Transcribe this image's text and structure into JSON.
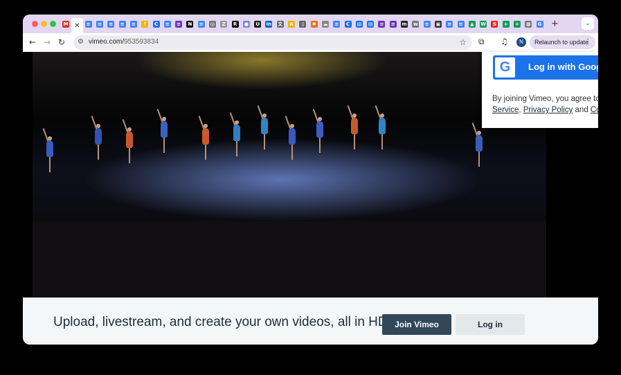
{
  "browser": {
    "tabs": [
      {
        "icon": "gmail-icon",
        "color": "#d93025",
        "glyph": "M"
      },
      {
        "icon": "close-icon",
        "active": true,
        "glyph": "✕"
      },
      {
        "icon": "docs-icon",
        "color": "#4285f4",
        "glyph": "≡"
      },
      {
        "icon": "docs-icon",
        "color": "#4285f4",
        "glyph": "≡"
      },
      {
        "icon": "docs-icon",
        "color": "#4285f4",
        "glyph": "≡"
      },
      {
        "icon": "docs-icon",
        "color": "#4285f4",
        "glyph": "≡"
      },
      {
        "icon": "docs-icon",
        "color": "#4285f4",
        "glyph": "≡"
      },
      {
        "icon": "upload-icon",
        "color": "#f4b400",
        "glyph": "↑"
      },
      {
        "icon": "chrome-c-icon",
        "color": "#1a73e8",
        "glyph": "C"
      },
      {
        "icon": "docs-icon",
        "color": "#4285f4",
        "glyph": "≡"
      },
      {
        "icon": "forms-icon",
        "color": "#673ab7",
        "glyph": "≡"
      },
      {
        "icon": "notion-icon",
        "color": "#111111",
        "glyph": "N"
      },
      {
        "icon": "docs-icon",
        "color": "#4285f4",
        "glyph": "≡"
      },
      {
        "icon": "globe-icon",
        "color": "#777777",
        "glyph": "◎"
      },
      {
        "icon": "zen-icon",
        "color": "#999999",
        "glyph": "Z"
      },
      {
        "icon": "r-icon",
        "color": "#111111",
        "glyph": "R"
      },
      {
        "icon": "circle-icon",
        "color": "#7b8bd4",
        "glyph": "●"
      },
      {
        "icon": "uo-icon",
        "color": "#222222",
        "glyph": "U"
      },
      {
        "icon": "linkedin-icon",
        "color": "#0a66c2",
        "glyph": "in"
      },
      {
        "icon": "translate-icon",
        "color": "#666666",
        "glyph": "文"
      },
      {
        "icon": "slides-icon",
        "color": "#f4b400",
        "glyph": "A"
      },
      {
        "icon": "doc-outline-icon",
        "color": "#666666",
        "glyph": "▯"
      },
      {
        "icon": "sparkle-icon",
        "color": "#e8710a",
        "glyph": "✱"
      },
      {
        "icon": "cloud-icon",
        "color": "#888888",
        "glyph": "☁"
      },
      {
        "icon": "docs-icon",
        "color": "#4285f4",
        "glyph": "≡"
      },
      {
        "icon": "chrome-c-icon",
        "color": "#1a73e8",
        "glyph": "C"
      },
      {
        "icon": "printer-icon",
        "color": "#1a73e8",
        "glyph": "▤"
      },
      {
        "icon": "printer-icon",
        "color": "#1a73e8",
        "glyph": "▤"
      },
      {
        "icon": "forms-icon",
        "color": "#673ab7",
        "glyph": "≡"
      },
      {
        "icon": "forms-icon",
        "color": "#673ab7",
        "glyph": "≡"
      },
      {
        "icon": "m-icon",
        "color": "#222222",
        "glyph": "m"
      },
      {
        "icon": "wiki-icon",
        "color": "#777777",
        "glyph": "w"
      },
      {
        "icon": "docs-icon",
        "color": "#4285f4",
        "glyph": "≡"
      },
      {
        "icon": "image-icon",
        "color": "#333333",
        "glyph": "▣"
      },
      {
        "icon": "docs-icon",
        "color": "#4285f4",
        "glyph": "≡"
      },
      {
        "icon": "docs-icon",
        "color": "#4285f4",
        "glyph": "≡"
      },
      {
        "icon": "drive-icon",
        "color": "#0f9d58",
        "glyph": "▲"
      },
      {
        "icon": "sheets-icon",
        "color": "#0f9d58",
        "glyph": "W"
      },
      {
        "icon": "sy-icon",
        "color": "#d93025",
        "glyph": "S"
      },
      {
        "icon": "sheets-icon",
        "color": "#0f9d58",
        "glyph": "+"
      },
      {
        "icon": "sheets-icon",
        "color": "#0f9d58",
        "glyph": "+"
      },
      {
        "icon": "table-icon",
        "color": "#777777",
        "glyph": "▦"
      },
      {
        "icon": "google-icon",
        "color": "#4285f4",
        "glyph": "G"
      }
    ],
    "url_host": "vimeo.com/",
    "url_path": "953593834",
    "relaunch_label": "Relaunch to update",
    "avatar_initial": "N"
  },
  "login_panel": {
    "google_button_label": "Log in with Google",
    "terms_prefix": "By joining Vimeo, you agree to our Terms of",
    "terms_service": "Service",
    "terms_privacy": "Privacy Policy",
    "terms_and": " and ",
    "terms_cookie": "Cookie Policy"
  },
  "banner": {
    "text": "Upload, livestream, and create your own videos, all in HD.",
    "join_label": "Join Vimeo",
    "login_label": "Log in"
  }
}
